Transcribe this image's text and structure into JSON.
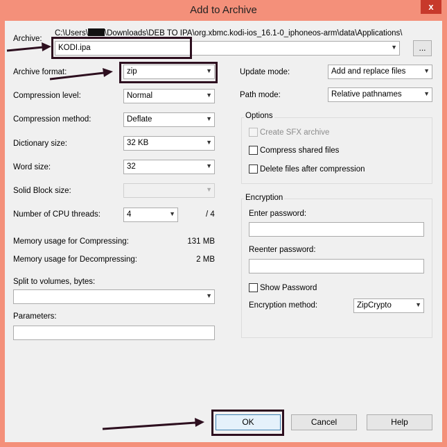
{
  "window": {
    "title": "Add to Archive",
    "close_glyph": "x"
  },
  "archive": {
    "label": "Archive:",
    "path_prefix": "C:\\Users\\",
    "path_suffix": "\\Downloads\\DEB TO IPA\\org.xbmc.kodi-ios_16.1-0_iphoneos-arm\\data\\Applications\\",
    "value": "KODI.ipa",
    "browse_label": "..."
  },
  "left": {
    "format_label": "Archive format:",
    "format_value": "zip",
    "level_label": "Compression level:",
    "level_value": "Normal",
    "method_label": "Compression method:",
    "method_value": "Deflate",
    "dict_label": "Dictionary size:",
    "dict_value": "32 KB",
    "word_label": "Word size:",
    "word_value": "32",
    "solid_label": "Solid Block size:",
    "solid_value": "",
    "cpu_label": "Number of CPU threads:",
    "cpu_value": "4",
    "cpu_total": "/ 4",
    "mem_comp_label": "Memory usage for Compressing:",
    "mem_comp_value": "131 MB",
    "mem_decomp_label": "Memory usage for Decompressing:",
    "mem_decomp_value": "2 MB",
    "split_label": "Split to volumes, bytes:",
    "split_value": "",
    "params_label": "Parameters:",
    "params_value": ""
  },
  "right": {
    "update_label": "Update mode:",
    "update_value": "Add and replace files",
    "pathmode_label": "Path mode:",
    "pathmode_value": "Relative pathnames",
    "options": {
      "title": "Options",
      "sfx": "Create SFX archive",
      "shared": "Compress shared files",
      "delete": "Delete files after compression"
    },
    "encryption": {
      "title": "Encryption",
      "enter_label": "Enter password:",
      "reenter_label": "Reenter password:",
      "show_label": "Show Password",
      "method_label": "Encryption method:",
      "method_value": "ZipCrypto"
    }
  },
  "buttons": {
    "ok": "OK",
    "cancel": "Cancel",
    "help": "Help"
  },
  "annotation": {
    "color": "#2d0f1f"
  }
}
